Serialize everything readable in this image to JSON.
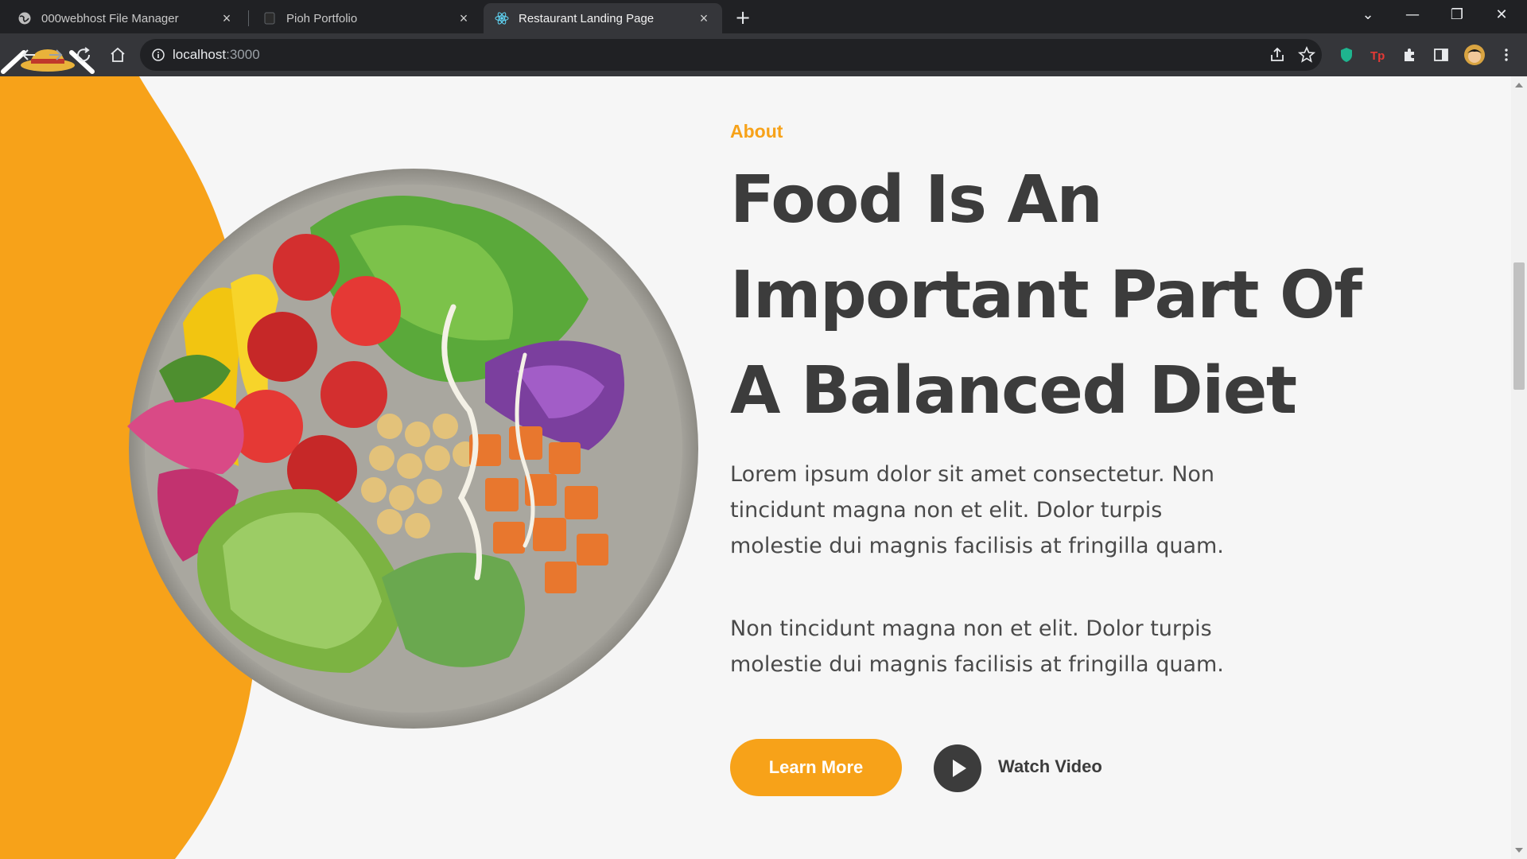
{
  "browser": {
    "tabs": [
      {
        "title": "000webhost File Manager",
        "icon": "globe-icon",
        "active": false
      },
      {
        "title": "Pioh Portfolio",
        "icon": "page-icon",
        "active": false
      },
      {
        "title": "Restaurant Landing Page",
        "icon": "react-icon",
        "active": true
      }
    ],
    "tab_close": "×",
    "new_tab": "+",
    "url_host": "localhost",
    "url_port": ":3000",
    "window_controls": {
      "menu": "⌄",
      "minimize": "—",
      "restore": "❐",
      "close": "✕"
    }
  },
  "about": {
    "label": "About",
    "headline": "Food Is An Important Part Of A Balanced Diet",
    "paragraph1": "Lorem ipsum dolor sit amet consectetur. Non tincidunt magna non et elit. Dolor turpis molestie dui magnis facilisis at fringilla quam.",
    "paragraph2": "Non tincidunt magna non et elit. Dolor turpis molestie dui magnis facilisis at fringilla quam.",
    "learn_more": "Learn More",
    "watch_video": "Watch Video"
  },
  "colors": {
    "accent": "#f7a219",
    "text_dark": "#3c3c3c",
    "background": "#f6f6f6",
    "chrome_dark": "#202124",
    "chrome_toolbar": "#35363a"
  }
}
